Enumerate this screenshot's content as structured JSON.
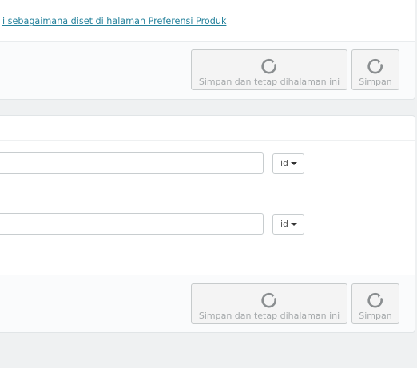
{
  "top_panel": {
    "preference_link": "i sebagaimana diset di halaman Preferensi Produk",
    "save_and_stay_label": "Simpan dan tetap dihalaman ini",
    "save_label": "Simpan"
  },
  "main_panel": {
    "field_1": {
      "value": "",
      "language": "id"
    },
    "field_2": {
      "value": "",
      "language": "id"
    },
    "save_and_stay_label": "Simpan dan tetap dihalaman ini",
    "save_label": "Simpan"
  },
  "icons": {
    "button_icon": "refresh-spinner-icon"
  },
  "colors": {
    "link": "#25829c",
    "button_text": "#a5a9ab",
    "background": "#eff1f2"
  }
}
